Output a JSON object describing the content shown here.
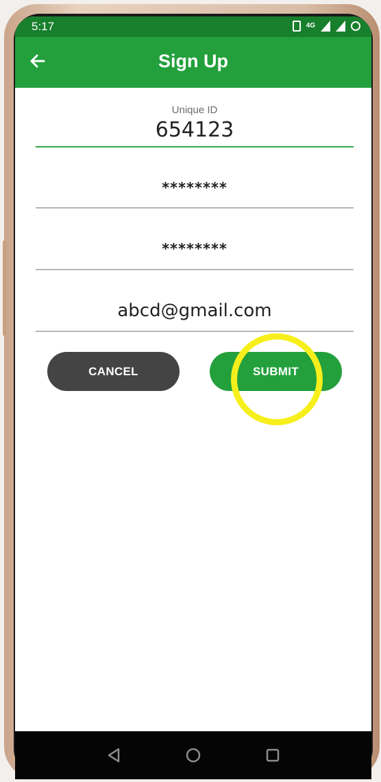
{
  "status_bar": {
    "time": "5:17",
    "network": "4G"
  },
  "app_bar": {
    "title": "Sign Up"
  },
  "form": {
    "unique_id": {
      "label": "Unique ID",
      "value": "654123"
    },
    "password": {
      "value": "********"
    },
    "confirm_password": {
      "value": "********"
    },
    "email": {
      "value": "abcd@gmail.com"
    }
  },
  "buttons": {
    "cancel": "CANCEL",
    "submit": "SUBMIT"
  },
  "colors": {
    "status_bar": "#187f2c",
    "app_bar": "#23a03c",
    "submit_button": "#23a03c",
    "cancel_button": "#444444",
    "highlight_ring": "#f7ef1c"
  },
  "icons": {
    "back": "arrow-left-icon",
    "nav_back": "triangle-back-icon",
    "nav_home": "circle-home-icon",
    "nav_recents": "square-recents-icon"
  }
}
